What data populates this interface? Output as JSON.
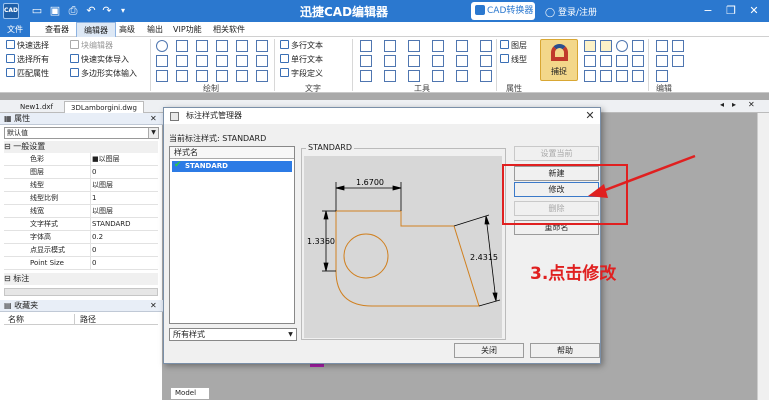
{
  "titlebar": {
    "app_icon": "CAD",
    "title": "迅捷CAD编辑器",
    "convert_button": "CAD转换器",
    "login": "登录/注册",
    "quick_access_icons": [
      "folder-icon",
      "save-icon",
      "print-icon",
      "undo-icon",
      "redo-icon",
      "dropdown-icon"
    ],
    "window_controls": [
      "minimize-icon",
      "restore-icon",
      "close-icon"
    ]
  },
  "tabs": [
    "文件",
    "查看器",
    "编辑器",
    "高级",
    "输出",
    "VIP功能",
    "相关软件"
  ],
  "active_tab": "编辑器",
  "ribbon": {
    "select_group": [
      "快速选择",
      "选择所有",
      "匹配属性"
    ],
    "block_group": [
      "块编辑器",
      "快速实体导入",
      "多边形实体输入"
    ],
    "groups": {
      "draw": "绘制",
      "text": "文字",
      "tools": "工具",
      "properties": "属性",
      "edit": "编辑"
    },
    "text_group": [
      "多行文本",
      "单行文本",
      "字段定义"
    ],
    "props_group": [
      "图层",
      "线型"
    ],
    "capture_label": "捕捉"
  },
  "doc_tabs": [
    "New1.dxf",
    "3DLamborgini.dwg"
  ],
  "active_doc": "3DLamborgini.dwg",
  "properties_panel": {
    "title": "属性",
    "selector": "默认值",
    "section_general": "一般设置",
    "rows": [
      {
        "key": "色彩",
        "value": "■以图层"
      },
      {
        "key": "图层",
        "value": "0"
      },
      {
        "key": "线型",
        "value": "以图层"
      },
      {
        "key": "线型比例",
        "value": "1"
      },
      {
        "key": "线宽",
        "value": "以图层"
      },
      {
        "key": "文字样式",
        "value": "STANDARD"
      },
      {
        "key": "字体高",
        "value": "0.2"
      },
      {
        "key": "点显示模式",
        "value": "0"
      },
      {
        "key": "Point Size",
        "value": "0"
      }
    ],
    "section_annotation": "标注"
  },
  "favorites_panel": {
    "title": "收藏夹",
    "columns": [
      "名称",
      "路径"
    ]
  },
  "model_tab": "Model",
  "dialog": {
    "title": "标注样式管理器",
    "current_label": "当前标注样式:",
    "current_value": "STANDARD",
    "list_header": "样式名",
    "styles": [
      "STANDARD"
    ],
    "filter_value": "所有样式",
    "preview_caption": "STANDARD",
    "preview_dims": [
      "1.6700",
      "1.3360",
      "2.4315"
    ],
    "buttons": {
      "set_current": "设置当前",
      "new": "新建",
      "modify": "修改",
      "delete": "删除",
      "rename": "重命名",
      "close": "关闭",
      "help": "帮助"
    }
  },
  "annotation": {
    "step_text": "3.点击修改",
    "color": "#e02020"
  }
}
